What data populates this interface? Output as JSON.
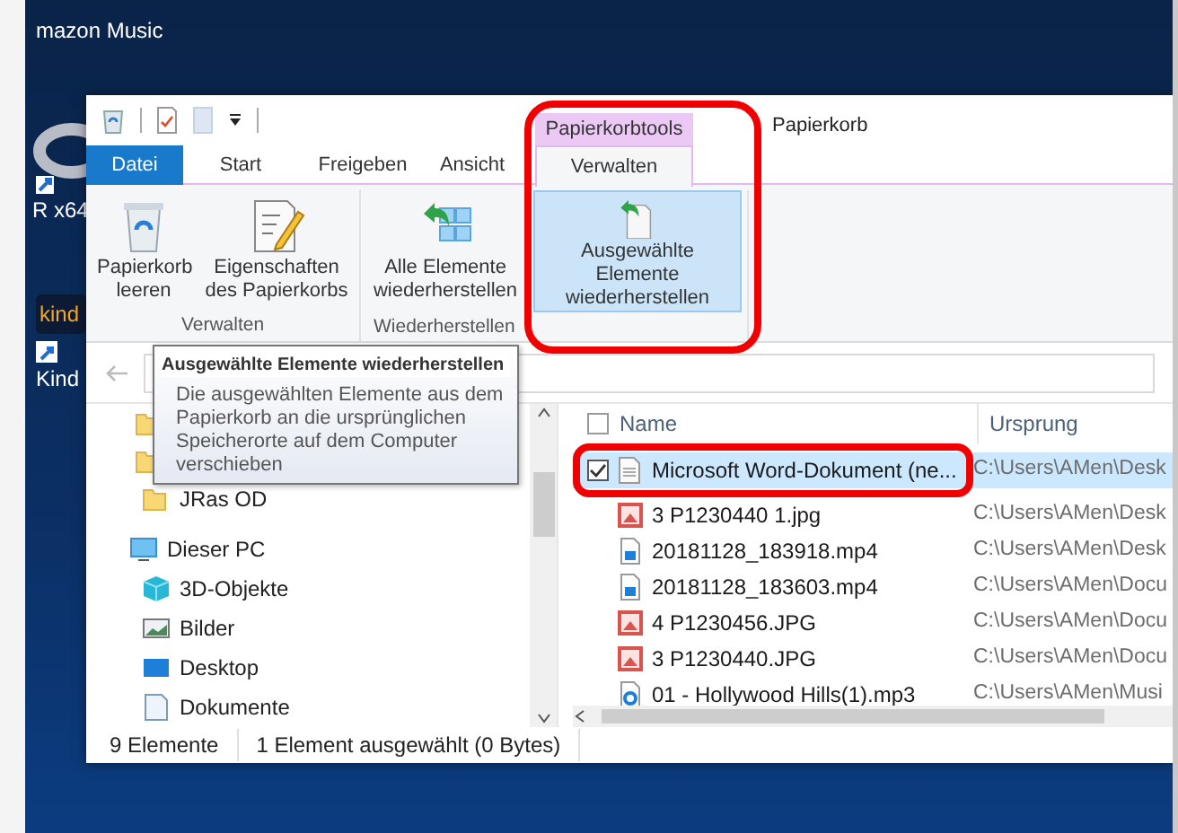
{
  "desktop": {
    "icons": [
      {
        "label": "mazon Music",
        "kind": "app"
      },
      {
        "label": "R x64",
        "kind": "r"
      },
      {
        "label": "Kind",
        "kind": "kindle",
        "badge": "kind"
      }
    ]
  },
  "window": {
    "context_tab": "Papierkorbtools",
    "title": "Papierkorb",
    "tabs": [
      {
        "label": "Datei",
        "kind": "file",
        "selected": false
      },
      {
        "label": "Start",
        "kind": "tab",
        "selected": false
      },
      {
        "label": "Freigeben",
        "kind": "tab",
        "selected": false
      },
      {
        "label": "Ansicht",
        "kind": "tab",
        "selected": false
      },
      {
        "label": "Verwalten",
        "kind": "context",
        "selected": true
      }
    ],
    "ribbon_groups": [
      {
        "label": "Verwalten",
        "buttons": [
          {
            "label": "Papierkorb leeren",
            "kind": "bin",
            "selected": false
          },
          {
            "label": "Eigenschaften des Papierkorbs",
            "kind": "props",
            "selected": false
          }
        ]
      },
      {
        "label": "Wiederherstellen",
        "buttons": [
          {
            "label": "Alle Elemente wiederherstellen",
            "kind": "restore_all",
            "selected": false
          },
          {
            "label": "Ausgewählte Elemente wiederherstellen",
            "kind": "restore",
            "selected": true
          }
        ]
      }
    ],
    "tooltip": {
      "title": "Ausgewählte Elemente wiederherstellen",
      "text": "Die ausgewählten Elemente aus dem Papierkorb an die ursprünglichen Speicherorte auf dem Computer verschieben"
    },
    "nav": [
      {
        "label": "JRas OD",
        "kind": "folder"
      },
      {
        "label": "Dieser PC",
        "kind": "pc",
        "children": [
          {
            "label": "3D-Objekte",
            "kind": "cube"
          },
          {
            "label": "Bilder",
            "kind": "pictures"
          },
          {
            "label": "Desktop",
            "kind": "desktop"
          },
          {
            "label": "Dokumente",
            "kind": "docs"
          }
        ]
      }
    ],
    "select_all": {
      "checked": false
    },
    "columns": [
      "Name",
      "Ursprung"
    ],
    "files": [
      {
        "name": "Microsoft Word-Dokument (ne...",
        "origin": "C:\\Users\\AMen\\Desk",
        "kind": "doc",
        "selected": true
      },
      {
        "name": "3 P1230440 1.jpg",
        "origin": "C:\\Users\\AMen\\Desk",
        "kind": "image",
        "selected": false
      },
      {
        "name": "20181128_183918.mp4",
        "origin": "C:\\Users\\AMen\\Desk",
        "kind": "video",
        "selected": false
      },
      {
        "name": "20181128_183603.mp4",
        "origin": "C:\\Users\\AMen\\Docu",
        "kind": "video",
        "selected": false
      },
      {
        "name": "4 P1230456.JPG",
        "origin": "C:\\Users\\AMen\\Docu",
        "kind": "image",
        "selected": false
      },
      {
        "name": "3 P1230440.JPG",
        "origin": "C:\\Users\\AMen\\Docu",
        "kind": "image",
        "selected": false
      },
      {
        "name": "01 - Hollywood Hills(1).mp3",
        "origin": "C:\\Users\\AMen\\Musi",
        "kind": "audio",
        "selected": false
      }
    ],
    "status_bar": [
      "9 Elemente",
      "1 Element ausgewählt (0 Bytes)"
    ]
  }
}
